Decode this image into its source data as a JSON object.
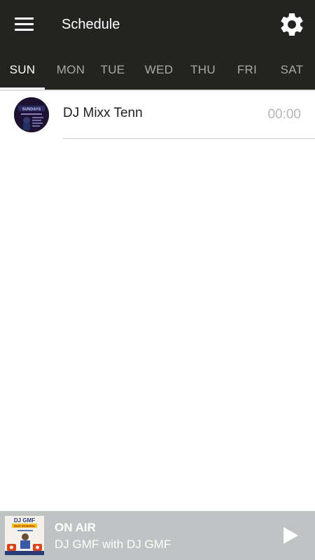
{
  "header": {
    "title": "Schedule",
    "menu_icon": "hamburger-menu-icon",
    "settings_icon": "gear-icon"
  },
  "tabs": [
    {
      "label": "SUN",
      "active": true
    },
    {
      "label": "MON",
      "active": false
    },
    {
      "label": "TUE",
      "active": false
    },
    {
      "label": "WED",
      "active": false
    },
    {
      "label": "THU",
      "active": false
    },
    {
      "label": "FRI",
      "active": false
    },
    {
      "label": "SAT",
      "active": false
    }
  ],
  "schedule": [
    {
      "name": "DJ Mixx Tenn",
      "time": "00:00",
      "avatar_text": "SUNDAYS"
    }
  ],
  "player": {
    "status": "ON AIR",
    "now_playing": "DJ GMF with DJ GMF",
    "art_title": "DJ GMF",
    "art_subtitle": "OLD SCHOOL",
    "play_icon": "play-icon"
  },
  "colors": {
    "appbar": "#232421",
    "tab_inactive": "#a9aaa6",
    "tab_active": "#ffffff",
    "player_bg": "#c0c3c4",
    "time_text": "#b5b5b5"
  }
}
